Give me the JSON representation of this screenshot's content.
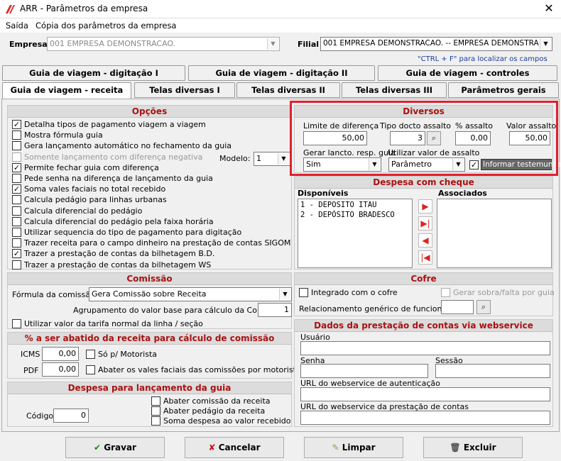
{
  "window": {
    "title": "ARR - Parâmetros da empresa"
  },
  "menu": {
    "saida": "Saída",
    "copia": "Cópia dos parâmetros da empresa"
  },
  "header": {
    "empresa_label": "Empresa",
    "empresa_value": "001 EMPRESA DEMONSTRACAO.",
    "filial_label": "Filial",
    "filial_value": "001 EMPRESA DEMONSTRACAO. -- EMPRESA DEMONSTRA",
    "hint": "\"CTRL + F\" para localizar os campos"
  },
  "tabs_row1": [
    "Guia de viagem - digitação I",
    "Guia de viagem - digitação II",
    "Guia de viagem - controles"
  ],
  "tabs_row2": [
    "Guia de viagem - receita",
    "Telas diversas I",
    "Telas diversas II",
    "Telas diversas III",
    "Parâmetros gerais"
  ],
  "opcoes": {
    "title": "Opções",
    "modelo_label": "Modelo:",
    "modelo_value": "1",
    "items": [
      {
        "label": "Detalha tipos de pagamento viagem a viagem",
        "checked": true,
        "disabled": false
      },
      {
        "label": "Mostra fórmula guia",
        "checked": false,
        "disabled": false
      },
      {
        "label": "Gera lançamento automático no fechamento da guia",
        "checked": false,
        "disabled": false
      },
      {
        "label": "Somente lançamento com diferença negativa",
        "checked": false,
        "disabled": true
      },
      {
        "label": "Permite fechar guia com diferença",
        "checked": true,
        "disabled": false
      },
      {
        "label": "Pede senha na diferença de lançamento da guia",
        "checked": false,
        "disabled": false
      },
      {
        "label": "Soma vales faciais no total recebido",
        "checked": true,
        "disabled": false
      },
      {
        "label": "Calcula pedágio para linhas urbanas",
        "checked": false,
        "disabled": false
      },
      {
        "label": "Calcula diferencial do pedágio",
        "checked": false,
        "disabled": false
      },
      {
        "label": "Calcula diferencial do pedágio pela faixa horária",
        "checked": false,
        "disabled": false
      },
      {
        "label": "Utilizar sequencia do tipo de pagamento para digitação",
        "checked": false,
        "disabled": false
      },
      {
        "label": "Trazer receita para o campo dinheiro na prestação de contas SIGOM",
        "checked": false,
        "disabled": false
      },
      {
        "label": "Trazer a prestação de contas da bilhetagem B.D.",
        "checked": true,
        "disabled": false
      },
      {
        "label": "Trazer a prestação de contas da bilhetagem WS",
        "checked": false,
        "disabled": false
      }
    ]
  },
  "diversos": {
    "title": "Diversos",
    "limite_label": "Limite de diferença",
    "limite_value": "50,00",
    "tipo_label": "Tipo docto assalto",
    "tipo_value": "3",
    "pct_label": "% assalto",
    "pct_value": "0,00",
    "valor_label": "Valor assalto",
    "valor_value": "50,00",
    "gerar_label": "Gerar lancto. resp. guia",
    "gerar_value": "Sim",
    "utilizar_label": "Utilizar valor de assalto",
    "utilizar_value": "Parâmetro",
    "informar_label": "Informar testemunha",
    "informar_checked": true
  },
  "despesa_cheque": {
    "title": "Despesa com cheque",
    "disp_label": "Disponíveis",
    "assoc_label": "Associados",
    "items": [
      "1 - DEPOSITO ITAU",
      "2 - DEPÓSITO BRADESCO"
    ]
  },
  "comissao": {
    "title": "Comissão",
    "formula_label": "Fórmula da comissão",
    "formula_value": "Gera Comissão sobre  Receita",
    "agrup_label": "Agrupamento do valor base para cálculo da Comissão",
    "agrup_value": "1",
    "tarifa_label": "Utilizar valor da tarifa normal da linha / seção"
  },
  "abatido": {
    "title": "% a ser abatido da receita para cálculo de comissão",
    "icms_label": "ICMS",
    "icms_value": "0,00",
    "pdf_label": "PDF",
    "pdf_value": "0,00",
    "so_motorista": "Só p/ Motorista",
    "abater_vales": "Abater os vales faciais das comissões por motoristas"
  },
  "despesa_lanc": {
    "title": "Despesa para lançamento da guia",
    "codigo_label": "Código",
    "codigo_value": "0",
    "abater_comissao": "Abater comissão da receita",
    "abater_pedagio": "Abater pedágio da receita",
    "soma_despesa": "Soma despesa ao valor recebido"
  },
  "cofre": {
    "title": "Cofre",
    "integrado": "Integrado com o cofre",
    "gerar_sobra": "Gerar sobra/falta por guia",
    "relac_label": "Relacionamento genérico de funcionários"
  },
  "webservice": {
    "title": "Dados da prestação de contas via webservice",
    "usuario": "Usuário",
    "senha": "Senha",
    "sessao": "Sessão",
    "url_auth": "URL do webservice de autenticação",
    "url_prest": "URL do webservice da prestação de contas"
  },
  "buttons": {
    "gravar": "Gravar",
    "cancelar": "Cancelar",
    "limpar": "Limpar",
    "excluir": "Excluir"
  }
}
